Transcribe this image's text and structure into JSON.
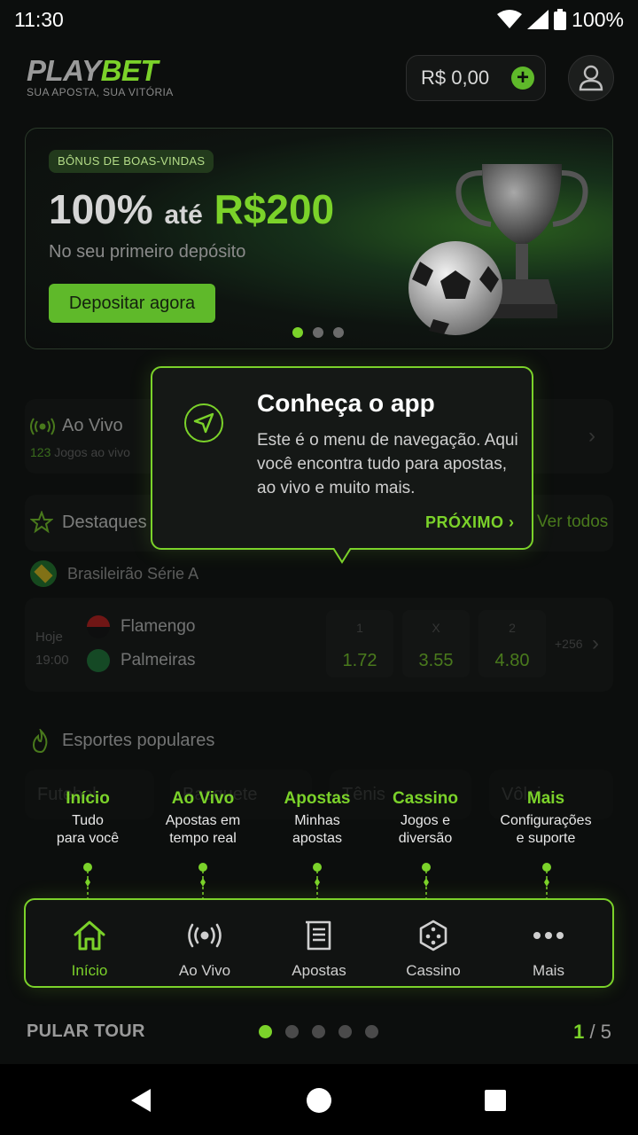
{
  "status_bar": {
    "time": "11:30",
    "battery": "100%"
  },
  "header": {
    "logo_play": "PLAY",
    "logo_bet": "BET",
    "tagline": "SUA APOSTA, SUA VITÓRIA",
    "balance": "R$ 0,00"
  },
  "banner": {
    "tag": "BÔNUS DE BOAS-VINDAS",
    "headline_percent": "100%",
    "headline_ate": "até",
    "headline_amount": "R$200",
    "subtitle": "No seu primeiro depósito",
    "button": "Depositar agora",
    "slides_total": 3,
    "slide_active": 1
  },
  "live": {
    "title": "Ao Vivo",
    "count": "123",
    "count_suffix": "Jogos ao vivo"
  },
  "featured": {
    "title": "Destaques",
    "see_all": "Ver todos"
  },
  "league": {
    "name": "Brasileirão Série A"
  },
  "match": {
    "day": "Hoje",
    "time": "19:00",
    "home": "Flamengo",
    "away": "Palmeiras",
    "odds": [
      {
        "label": "1",
        "value": "1.72"
      },
      {
        "label": "X",
        "value": "3.55"
      },
      {
        "label": "2",
        "value": "4.80"
      }
    ],
    "more": "+256"
  },
  "popular": {
    "title": "Esportes populares",
    "chips": [
      "Futebol",
      "Basquete",
      "Tênis",
      "Vôlei"
    ]
  },
  "tooltip": {
    "title": "Conheça o app",
    "body": "Este é o menu de navegação. Aqui você encontra tudo para apostas, ao vivo e muito mais.",
    "next": "PRÓXIMO"
  },
  "nav_labels": [
    {
      "title": "Início",
      "desc1": "Tudo",
      "desc2": "para você"
    },
    {
      "title": "Ao Vivo",
      "desc1": "Apostas em",
      "desc2": "tempo real"
    },
    {
      "title": "Apostas",
      "desc1": "Minhas",
      "desc2": "apostas"
    },
    {
      "title": "Cassino",
      "desc1": "Jogos e",
      "desc2": "diversão"
    },
    {
      "title": "Mais",
      "desc1": "Configurações",
      "desc2": "e suporte"
    }
  ],
  "bottom_nav": [
    {
      "label": "Início",
      "icon": "home-icon",
      "active": true
    },
    {
      "label": "Ao Vivo",
      "icon": "live-broadcast-icon",
      "active": false
    },
    {
      "label": "Apostas",
      "icon": "bet-slip-icon",
      "active": false
    },
    {
      "label": "Cassino",
      "icon": "dice-icon",
      "active": false
    },
    {
      "label": "Mais",
      "icon": "more-dots-icon",
      "active": false
    }
  ],
  "tour": {
    "skip": "PULAR TOUR",
    "current": "1",
    "separator": " / ",
    "total": "5",
    "steps": 5
  },
  "colors": {
    "accent": "#7bd22a",
    "background": "#0c0e0d",
    "card": "#141615"
  }
}
